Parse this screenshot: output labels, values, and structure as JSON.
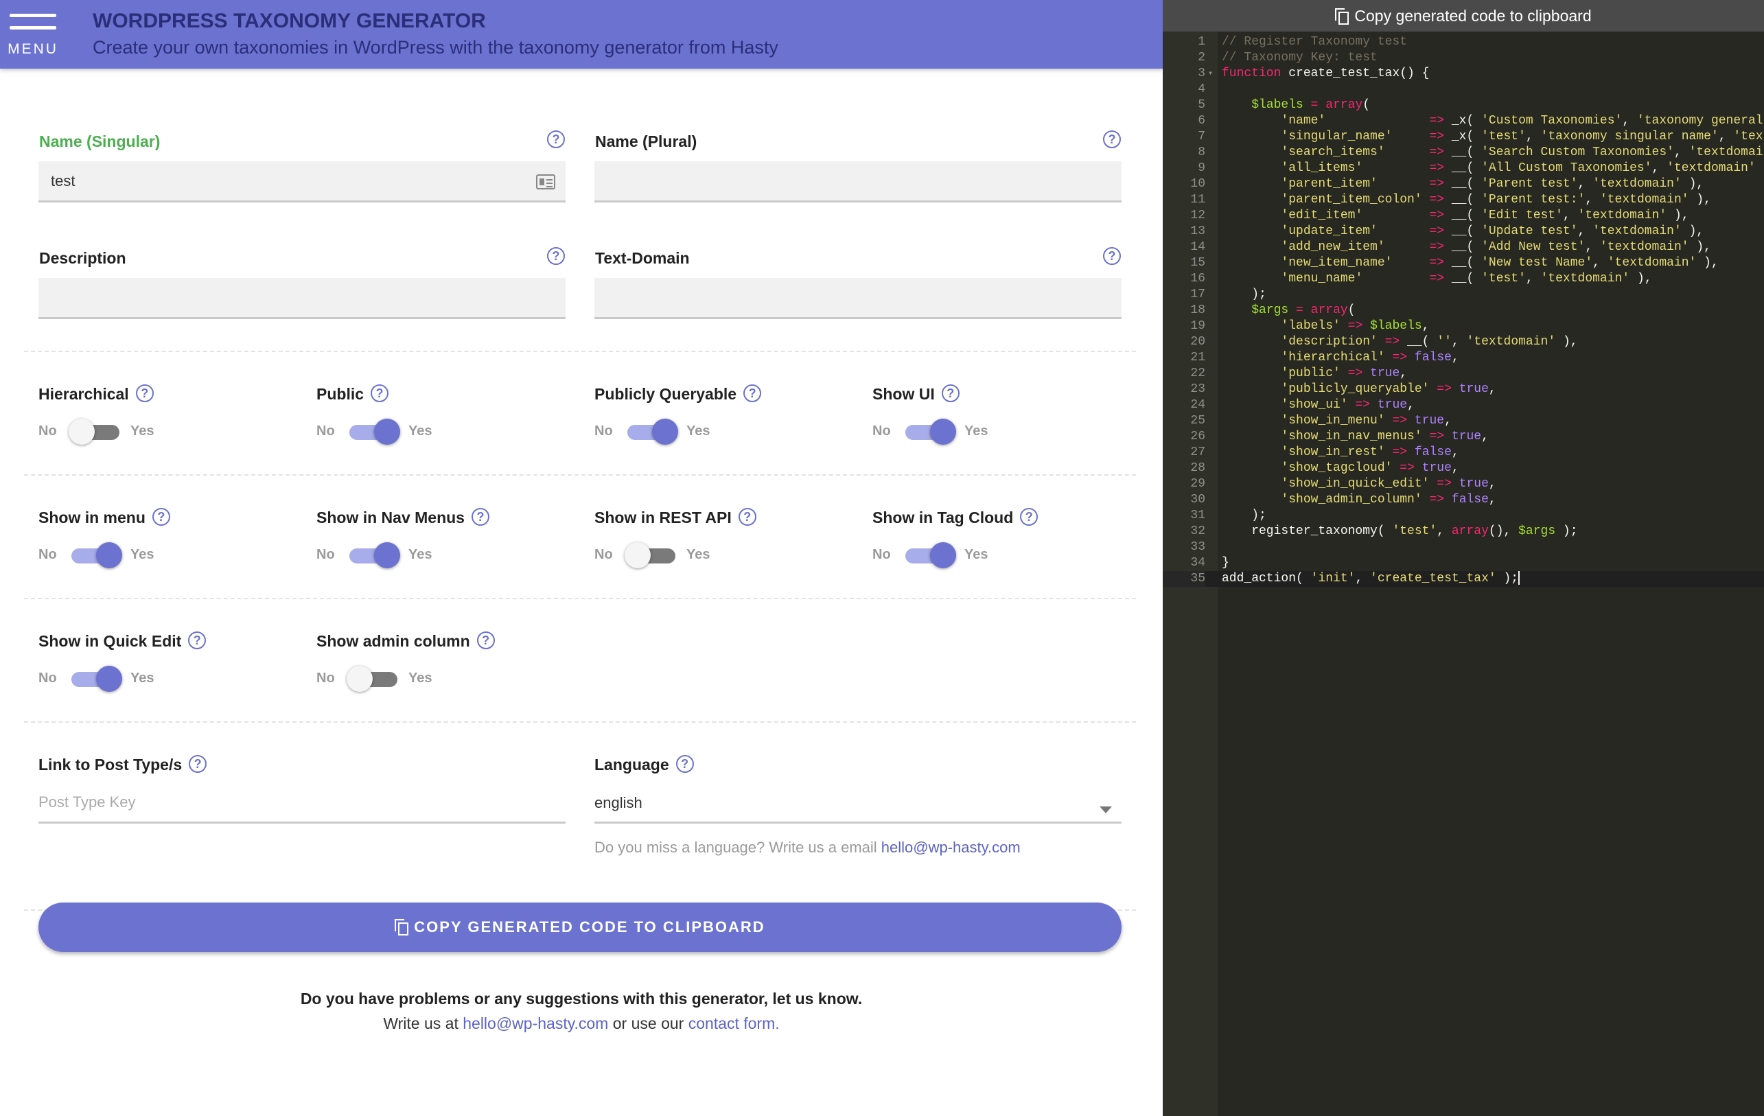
{
  "header": {
    "menu_label": "MENU",
    "title": "WORDPRESS TAXONOMY GENERATOR",
    "subtitle": "Create your own taxonomies in WordPress with the taxonomy generator from Hasty"
  },
  "fields": {
    "name_singular": {
      "label": "Name (Singular)",
      "value": "test"
    },
    "name_plural": {
      "label": "Name (Plural)",
      "value": ""
    },
    "description": {
      "label": "Description",
      "value": ""
    },
    "text_domain": {
      "label": "Text-Domain",
      "value": ""
    }
  },
  "help_glyph": "?",
  "toggle_text": {
    "no": "No",
    "yes": "Yes"
  },
  "toggles": {
    "hierarchical": {
      "label": "Hierarchical",
      "on": false
    },
    "public": {
      "label": "Public",
      "on": true
    },
    "publicly_queryable": {
      "label": "Publicly Queryable",
      "on": true
    },
    "show_ui": {
      "label": "Show UI",
      "on": true
    },
    "show_in_menu": {
      "label": "Show in menu",
      "on": true
    },
    "show_in_nav_menus": {
      "label": "Show in Nav Menus",
      "on": true
    },
    "show_in_rest": {
      "label": "Show in REST API",
      "on": false
    },
    "show_in_tag_cloud": {
      "label": "Show in Tag Cloud",
      "on": true
    },
    "show_in_quick_edit": {
      "label": "Show in Quick Edit",
      "on": true
    },
    "show_admin_column": {
      "label": "Show admin column",
      "on": false
    }
  },
  "link_post_types": {
    "label": "Link to Post Type/s",
    "placeholder": "Post Type Key"
  },
  "language": {
    "label": "Language",
    "selected": "english",
    "note": "Do you miss a language? Write us a email ",
    "note_email": "hello@wp-hasty.com"
  },
  "copy_button_label": "COPY GENERATED CODE TO CLIPBOARD",
  "footer": {
    "bold": "Do you have problems or any suggestions with this generator, let us know.",
    "prefix": "Write us at ",
    "email": "hello@wp-hasty.com",
    "middle": " or use our ",
    "contact": "contact form."
  },
  "code_panel": {
    "copy_label": "Copy generated code to clipboard",
    "lines": [
      "// Register Taxonomy test",
      "// Taxonomy Key: test",
      "function create_test_tax() {",
      "",
      "    $labels = array(",
      "        'name'              => _x( 'Custom Taxonomies', 'taxonomy general name', 'textdomain' ),",
      "        'singular_name'     => _x( 'test', 'taxonomy singular name', 'textdomain' ),",
      "        'search_items'      => __( 'Search Custom Taxonomies', 'textdomain' ),",
      "        'all_items'         => __( 'All Custom Taxonomies', 'textdomain' ),",
      "        'parent_item'       => __( 'Parent test', 'textdomain' ),",
      "        'parent_item_colon' => __( 'Parent test:', 'textdomain' ),",
      "        'edit_item'         => __( 'Edit test', 'textdomain' ),",
      "        'update_item'       => __( 'Update test', 'textdomain' ),",
      "        'add_new_item'      => __( 'Add New test', 'textdomain' ),",
      "        'new_item_name'     => __( 'New test Name', 'textdomain' ),",
      "        'menu_name'         => __( 'test', 'textdomain' ),",
      "    );",
      "    $args = array(",
      "        'labels' => $labels,",
      "        'description' => __( '', 'textdomain' ),",
      "        'hierarchical' => false,",
      "        'public' => true,",
      "        'publicly_queryable' => true,",
      "        'show_ui' => true,",
      "        'show_in_menu' => true,",
      "        'show_in_nav_menus' => true,",
      "        'show_in_rest' => false,",
      "        'show_tagcloud' => true,",
      "        'show_in_quick_edit' => true,",
      "        'show_admin_column' => false,",
      "    );",
      "    register_taxonomy( 'test', array(), $args );",
      "",
      "}",
      "add_action( 'init', 'create_test_tax' );"
    ],
    "colors": {
      "comment": "#75715e",
      "string": "#e6db74",
      "keyword": "#f92672",
      "variable": "#a6e22e",
      "constant": "#ae81ff",
      "default": "#f8f8f2"
    }
  },
  "colors": {
    "accent": "#6b72cf",
    "title_text": "#2b2f7a",
    "active_label": "#4caf50",
    "code_bg": "#272822"
  }
}
